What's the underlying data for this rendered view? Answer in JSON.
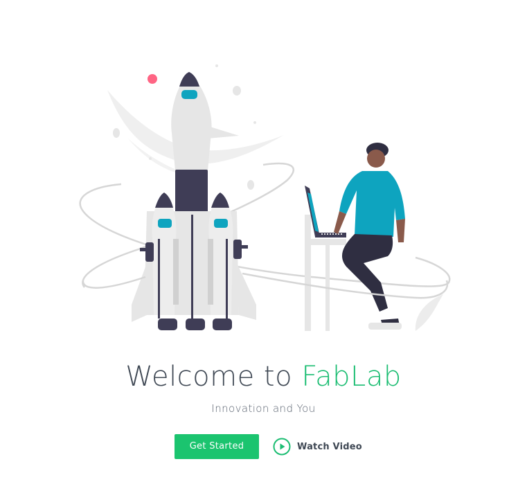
{
  "hero": {
    "title_prefix": "Welcome to ",
    "title_brand": "FabLab",
    "subtitle": "Innovation and You",
    "illustration_icon": "rocket-launch-illustration-icon"
  },
  "actions": {
    "get_started_label": "Get Started",
    "watch_video_label": "Watch Video",
    "watch_video_icon": "play-circle-icon"
  },
  "colors": {
    "brand_green": "#1bbd72",
    "button_green": "#1bc46f",
    "text_dark": "#3f4854",
    "rocket_dark": "#3f3d56",
    "accent_teal": "#0ea4bf",
    "accent_pink": "#ff6584"
  }
}
